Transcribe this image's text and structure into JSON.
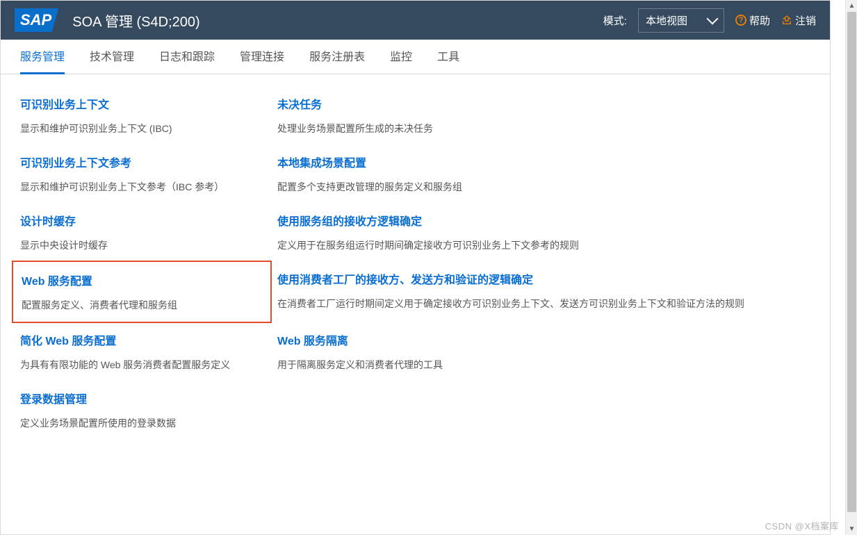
{
  "header": {
    "logo": "SAP",
    "title": "SOA 管理 (S4D;200)",
    "mode_label": "模式:",
    "mode_value": "本地视图",
    "help": "帮助",
    "logout": "注销"
  },
  "tabs": [
    {
      "label": "服务管理",
      "active": true
    },
    {
      "label": "技术管理",
      "active": false
    },
    {
      "label": "日志和跟踪",
      "active": false
    },
    {
      "label": "管理连接",
      "active": false
    },
    {
      "label": "服务注册表",
      "active": false
    },
    {
      "label": "监控",
      "active": false
    },
    {
      "label": "工具",
      "active": false
    }
  ],
  "cards": {
    "left": [
      {
        "title": "可识别业务上下文",
        "desc": "显示和维护可识别业务上下文 (IBC)"
      },
      {
        "title": "可识别业务上下文参考",
        "desc": "显示和维护可识别业务上下文参考（IBC 参考）"
      },
      {
        "title": "设计时缓存",
        "desc": "显示中央设计时缓存"
      },
      {
        "title": "Web 服务配置",
        "desc": "配置服务定义、消费者代理和服务组",
        "highlight": true
      },
      {
        "title": "简化 Web 服务配置",
        "desc": "为具有有限功能的 Web 服务消费者配置服务定义"
      },
      {
        "title": "登录数据管理",
        "desc": "定义业务场景配置所使用的登录数据"
      }
    ],
    "right": [
      {
        "title": "未决任务",
        "desc": "处理业务场景配置所生成的未决任务"
      },
      {
        "title": "本地集成场景配置",
        "desc": "配置多个支持更改管理的服务定义和服务组"
      },
      {
        "title": "使用服务组的接收方逻辑确定",
        "desc": "定义用于在服务组运行时期间确定接收方可识别业务上下文参考的规则"
      },
      {
        "title": "使用消费者工厂的接收方、发送方和验证的逻辑确定",
        "desc": "在消费者工厂运行时期间定义用于确定接收方可识别业务上下文、发送方可识别业务上下文和验证方法的规则"
      },
      {
        "title": "Web 服务隔离",
        "desc": "用于隔离服务定义和消费者代理的工具"
      }
    ]
  },
  "watermark": "CSDN @X档案库"
}
